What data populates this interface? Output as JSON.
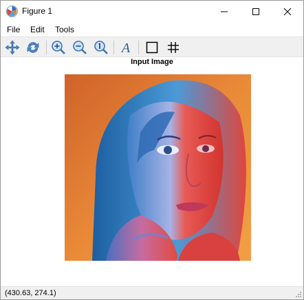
{
  "window": {
    "title": "Figure 1",
    "icon": "matplotlib-icon",
    "controls": [
      "minimize-icon",
      "maximize-icon",
      "close-icon"
    ]
  },
  "menu": {
    "items": [
      "File",
      "Edit",
      "Tools"
    ]
  },
  "toolbar": {
    "tools": [
      "pan-icon",
      "rotate-icon",
      "zoom-in-icon",
      "zoom-out-icon",
      "zoom-fit-icon",
      "text-icon",
      "axes-box-icon",
      "grid-icon"
    ]
  },
  "figure": {
    "title": "Input Image"
  },
  "status": {
    "coordinates": "(430.63, 274.1)"
  }
}
